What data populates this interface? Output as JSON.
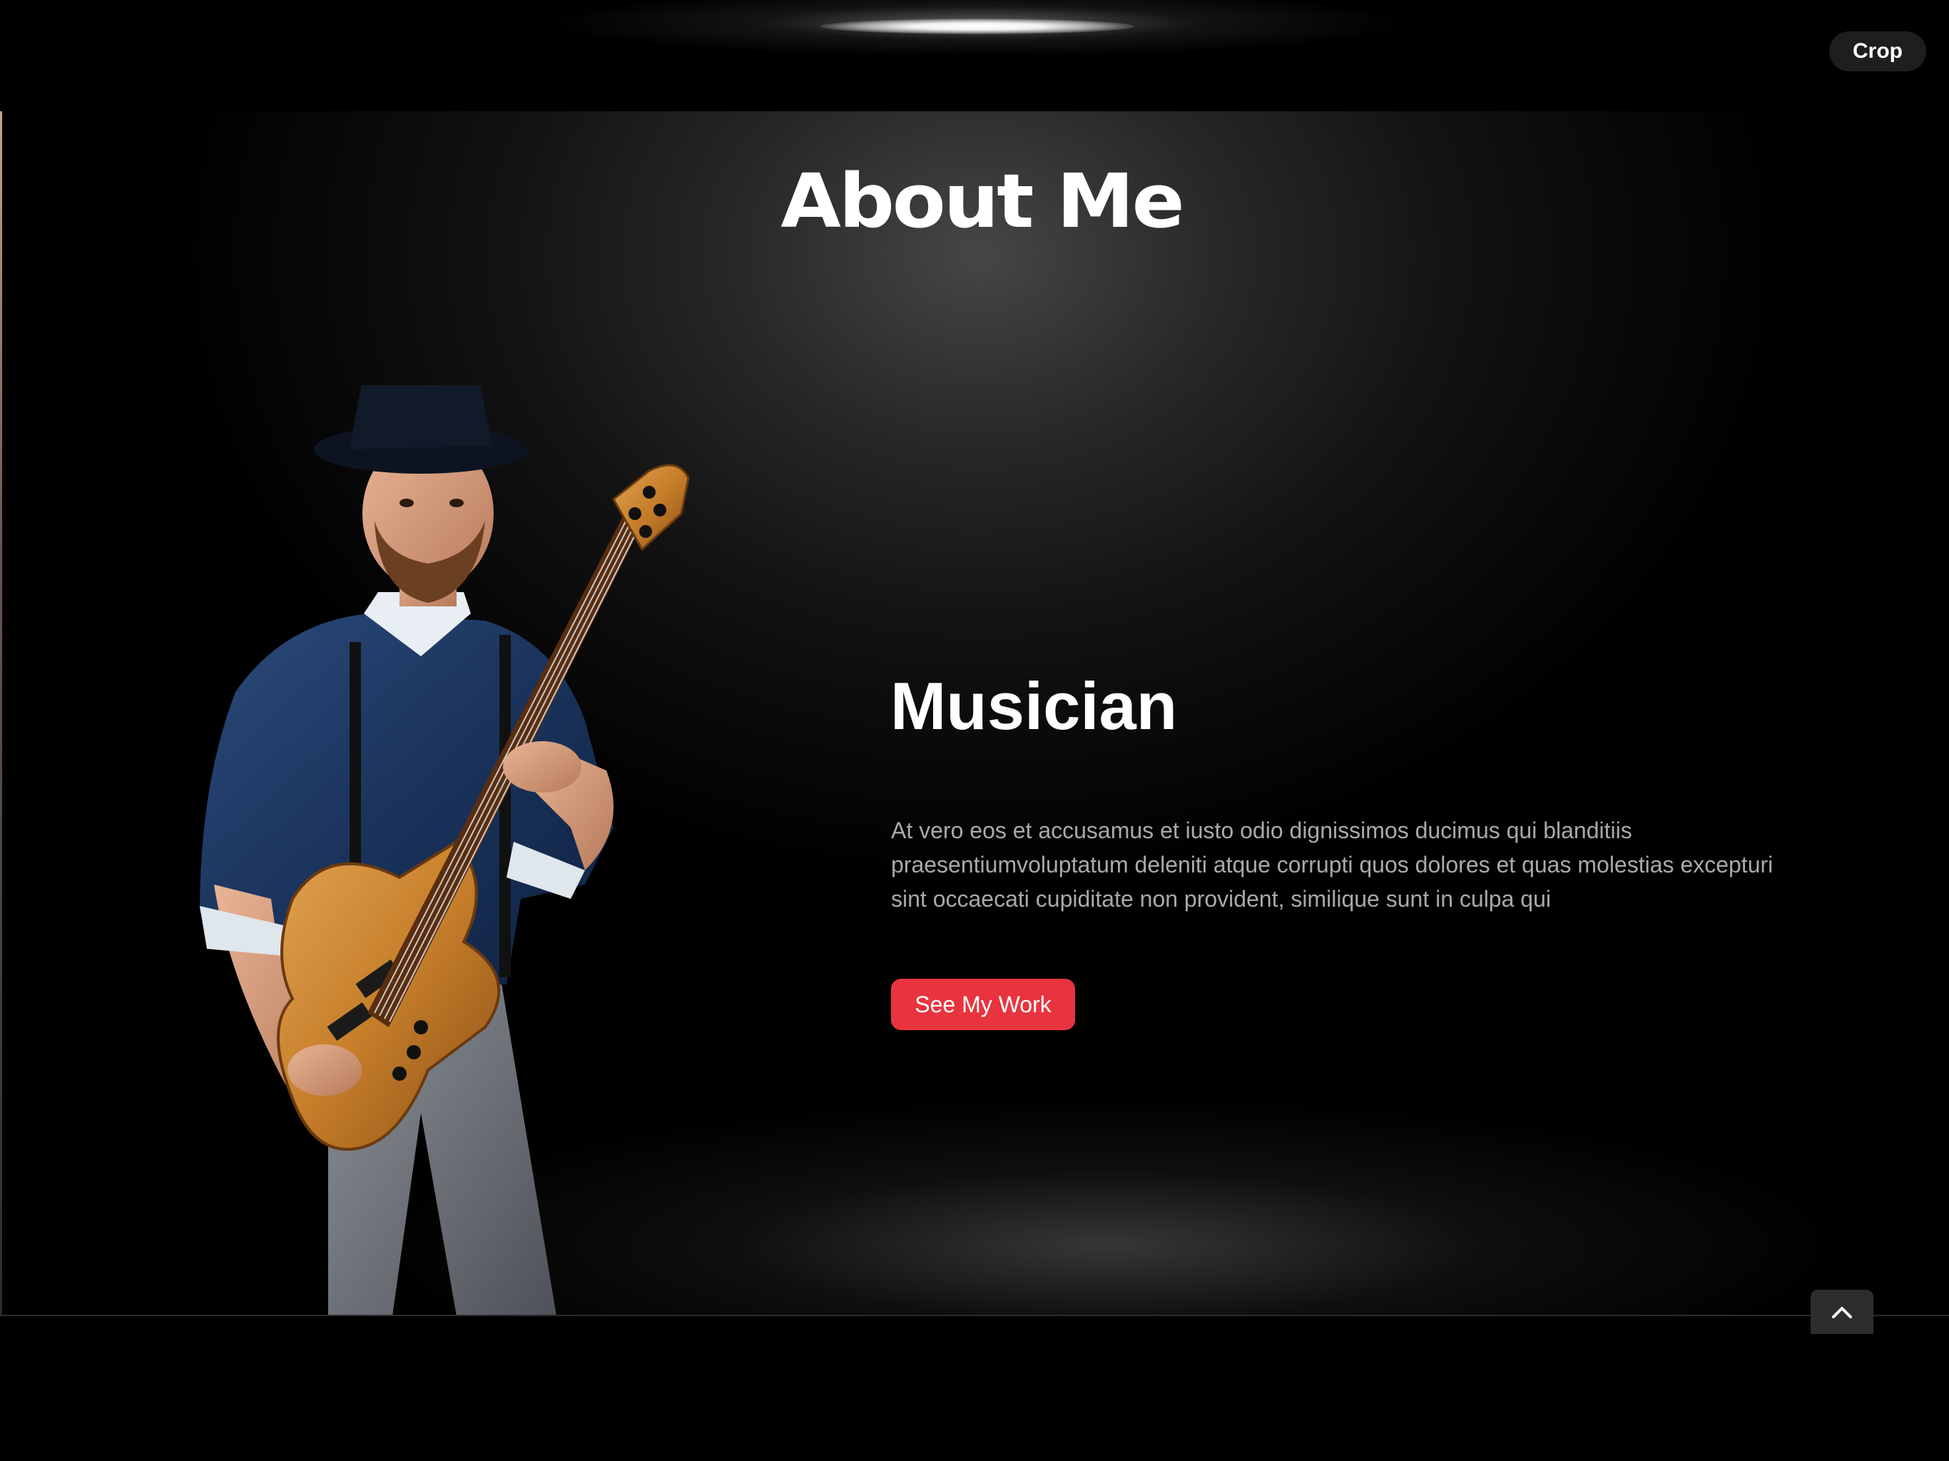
{
  "toolbar": {
    "crop_label": "Crop"
  },
  "section": {
    "title": "About Me",
    "role": "Musician",
    "bio": "At vero eos et accusamus et iusto odio dignissimos ducimus qui blanditiis praesentiumvoluptatum deleniti atque corrupti quos dolores et quas molestias excepturi sint occaecati cupiditate non provident, similique sunt in culpa qui",
    "cta_label": "See My Work"
  },
  "icons": {
    "scroll_top": "chevron-up-icon"
  },
  "colors": {
    "background": "#000000",
    "accent": "#e8343e",
    "text_primary": "#ffffff",
    "text_secondary": "#a9a9a9"
  }
}
